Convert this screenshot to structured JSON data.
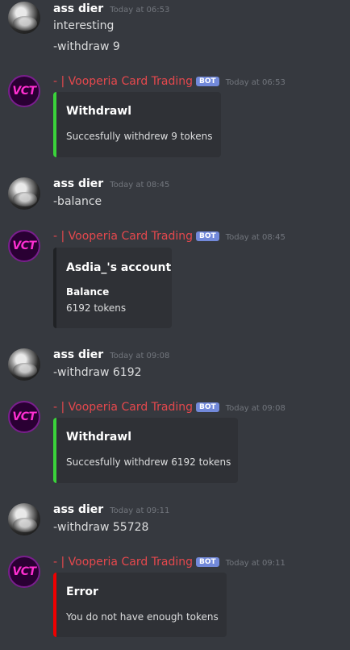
{
  "bot_badge": "BOT",
  "messages": [
    {
      "author": "ass dier",
      "time": "Today at 06:53",
      "lines": [
        "interesting",
        "-withdraw 9"
      ]
    },
    {
      "author": "- | Vooperia Card Trading",
      "avatar_text": "VCT",
      "time": "Today at 06:53",
      "embed": {
        "title": "Withdrawl",
        "description": "Succesfully withdrew 9 tokens",
        "color": "#3ad33a"
      }
    },
    {
      "author": "ass dier",
      "time": "Today at 08:45",
      "lines": [
        "-balance"
      ]
    },
    {
      "author": "- | Vooperia Card Trading",
      "avatar_text": "VCT",
      "time": "Today at 08:45",
      "embed": {
        "title": "Asdia_'s account",
        "field_name": "Balance",
        "field_value": "6192 tokens",
        "color": "#202225"
      }
    },
    {
      "author": "ass dier",
      "time": "Today at 09:08",
      "lines": [
        "-withdraw 6192"
      ]
    },
    {
      "author": "- | Vooperia Card Trading",
      "avatar_text": "VCT",
      "time": "Today at 09:08",
      "embed": {
        "title": "Withdrawl",
        "description": "Succesfully withdrew 6192 tokens",
        "color": "#3ad33a"
      }
    },
    {
      "author": "ass dier",
      "time": "Today at 09:11",
      "lines": [
        "-withdraw 55728"
      ]
    },
    {
      "author": "- | Vooperia Card Trading",
      "avatar_text": "VCT",
      "time": "Today at 09:11",
      "embed": {
        "title": "Error",
        "description": "You do not have enough tokens",
        "color": "#f00000"
      }
    }
  ]
}
